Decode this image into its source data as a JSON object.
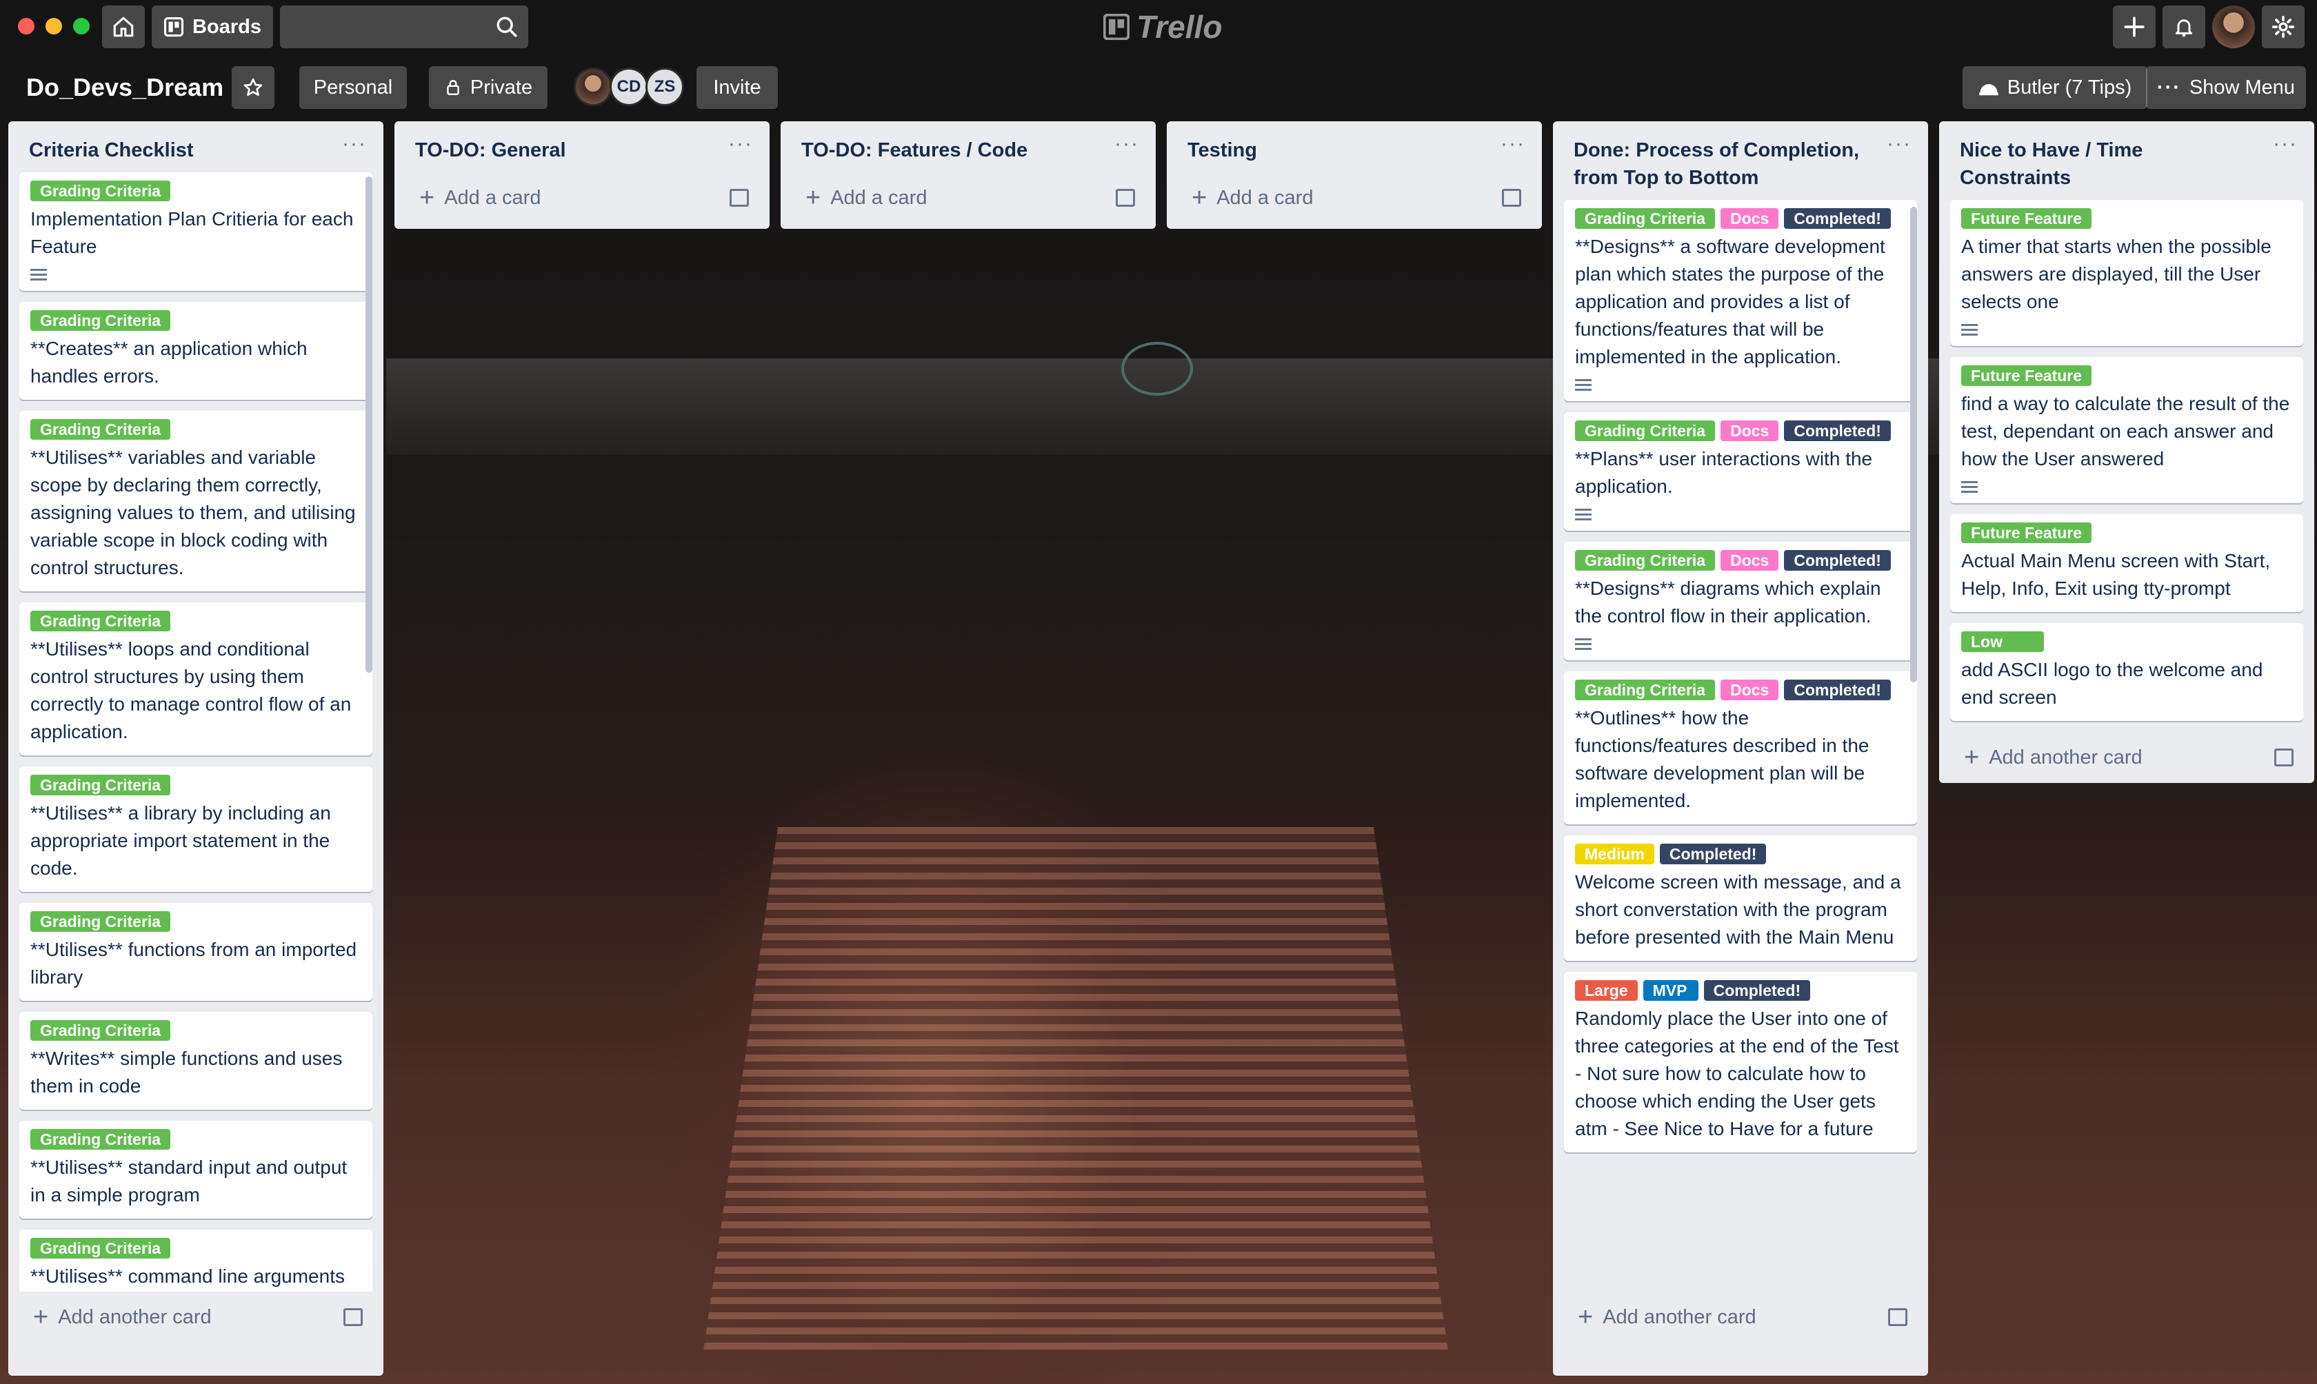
{
  "topbar": {
    "boards_label": "Boards",
    "logo_text": "Trello"
  },
  "board": {
    "title": "Do_Devs_Dream",
    "team_label": "Personal",
    "visibility_label": "Private",
    "members": [
      "CD",
      "ZS"
    ],
    "invite_label": "Invite",
    "butler_label": "Butler (7 Tips)",
    "show_menu_label": "Show Menu"
  },
  "colors": {
    "green": "#61bd4f",
    "pink": "#ff78cb",
    "dark": "#344563",
    "yellow": "#f2d600",
    "red": "#eb5a46",
    "blue": "#0079bf"
  },
  "lists": [
    {
      "title": "Criteria Checklist",
      "footer": "Add another card",
      "cards": [
        {
          "labels": [
            "Grading Criteria"
          ],
          "title": "Implementation Plan Critieria for each Feature"
        },
        {
          "labels": [
            "Grading Criteria"
          ],
          "title": "**Creates** an application which handles errors."
        },
        {
          "labels": [
            "Grading Criteria"
          ],
          "title": "**Utilises** variables and variable scope by declaring them correctly, assigning values to them, and utilising variable scope in block coding with control structures."
        },
        {
          "labels": [
            "Grading Criteria"
          ],
          "title": "**Utilises** loops and conditional control structures by using them correctly to manage control flow of an application."
        },
        {
          "labels": [
            "Grading Criteria"
          ],
          "title": "**Utilises** a library by including an appropriate import statement in the code."
        },
        {
          "labels": [
            "Grading Criteria"
          ],
          "title": "**Utilises** functions from an imported library"
        },
        {
          "labels": [
            "Grading Criteria"
          ],
          "title": "**Writes** simple functions and uses them in code"
        },
        {
          "labels": [
            "Grading Criteria"
          ],
          "title": "**Utilises** standard input and output in a simple program"
        },
        {
          "labels": [
            "Grading Criteria"
          ],
          "title": "**Utilises** command line arguments"
        }
      ]
    },
    {
      "title": "TO-DO: General",
      "footer": "Add a card",
      "cards": []
    },
    {
      "title": "TO-DO: Features / Code",
      "footer": "Add a card",
      "cards": []
    },
    {
      "title": "Testing",
      "footer": "Add a card",
      "cards": []
    },
    {
      "title": "Done: Process of Completion, from Top to Bottom",
      "footer": "Add another card",
      "cards": [
        {
          "labels": [
            "Grading Criteria",
            "Docs",
            "Completed!"
          ],
          "title": "**Designs** a software development plan which states the purpose of the application and provides a list of functions/features that will be implemented in the application."
        },
        {
          "labels": [
            "Grading Criteria",
            "Docs",
            "Completed!"
          ],
          "title": "**Plans** user interactions with the application."
        },
        {
          "labels": [
            "Grading Criteria",
            "Docs",
            "Completed!"
          ],
          "title": "**Designs** diagrams which explain the control flow in their application."
        },
        {
          "labels": [
            "Grading Criteria",
            "Docs",
            "Completed!"
          ],
          "title": "**Outlines** how the functions/features described in the software development plan will be implemented."
        },
        {
          "labels": [
            "Medium",
            "Completed!"
          ],
          "title": "Welcome screen with message, and a short converstation with the program before presented with the Main Menu"
        },
        {
          "labels": [
            "Large",
            "MVP",
            "Completed!"
          ],
          "title": "Randomly place the User into one of three categories at the end of the Test - Not sure how to calculate how to choose which ending the User gets atm - See Nice to Have for a future"
        }
      ]
    },
    {
      "title": "Nice to Have / Time Constraints",
      "footer": "Add another card",
      "cards": [
        {
          "labels": [
            "Future Feature"
          ],
          "title": "A timer that starts when the possible answers are displayed, till the User selects one"
        },
        {
          "labels": [
            "Future Feature"
          ],
          "title": "find a way to calculate the result of the test, dependant on each answer and how the User answered"
        },
        {
          "labels": [
            "Future Feature"
          ],
          "title": "Actual Main Menu screen with Start, Help, Info, Exit using tty-prompt"
        },
        {
          "labels": [
            "Low"
          ],
          "title": "add ASCII logo to the welcome and end screen"
        }
      ]
    }
  ]
}
